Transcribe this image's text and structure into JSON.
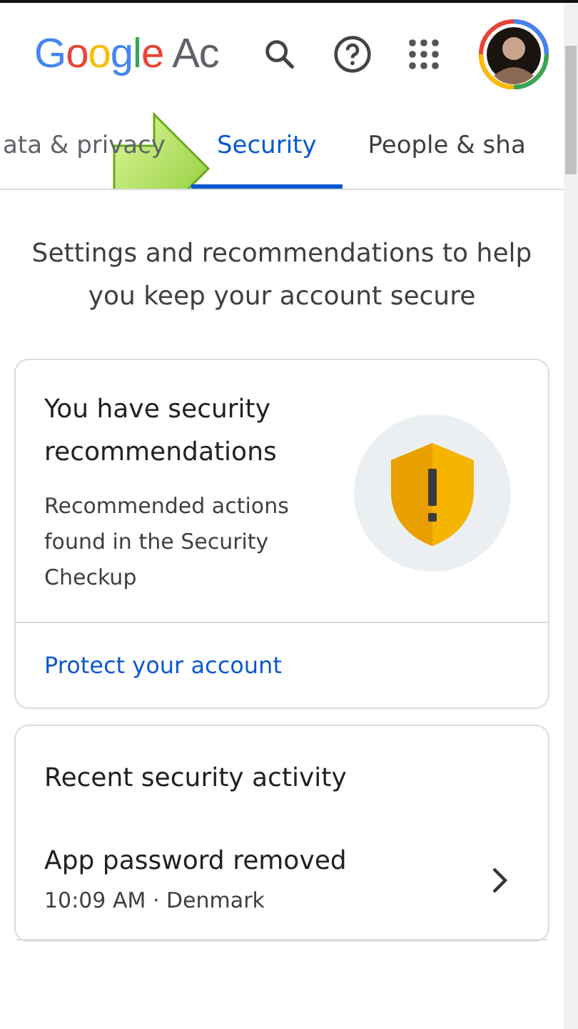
{
  "header": {
    "logo_brand": "Google",
    "logo_product": "Ac"
  },
  "tabs": [
    {
      "label": "ata & privacy",
      "selected": false
    },
    {
      "label": "Security",
      "selected": true
    },
    {
      "label": "People & sha",
      "selected": false
    }
  ],
  "intro": "Settings and recommendations to help you keep your account secure",
  "recommendation_card": {
    "title": "You have security recommendations",
    "body": "Recommended actions found in the Security Checkup",
    "link": "Protect your account"
  },
  "activity_card": {
    "title": "Recent security activity",
    "items": [
      {
        "title": "App password removed",
        "detail": "10:09 AM · Denmark"
      }
    ]
  }
}
